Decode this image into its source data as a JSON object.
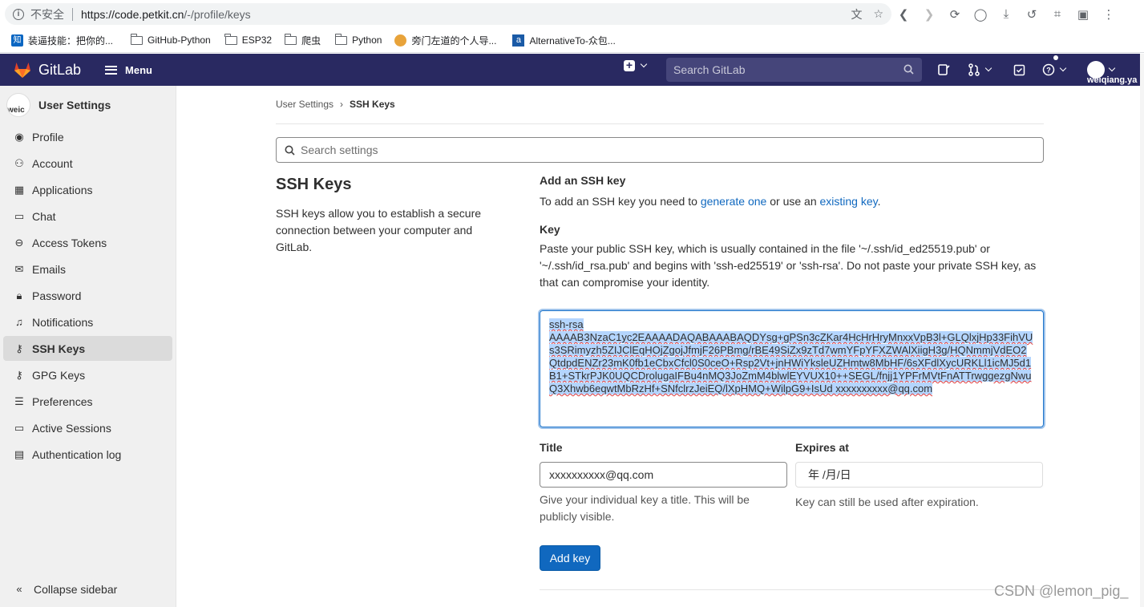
{
  "browser": {
    "insecure_label": "不安全",
    "url_host": "https://code.petkit.cn",
    "url_path": "/-/profile/keys",
    "bookmarks": [
      {
        "icon": "zhi-icon",
        "label": "装逼技能：把你的..."
      },
      {
        "icon": "folder-icon",
        "label": "GitHub-Python"
      },
      {
        "icon": "folder-icon",
        "label": "ESP32"
      },
      {
        "icon": "folder-icon",
        "label": "爬虫"
      },
      {
        "icon": "folder-icon",
        "label": "Python"
      },
      {
        "icon": "cat-icon",
        "label": "旁门左道的个人导..."
      },
      {
        "icon": "alternativeto-icon",
        "label": "AlternativeTo-众包..."
      }
    ]
  },
  "header": {
    "app_name": "GitLab",
    "menu_label": "Menu",
    "search_placeholder": "Search GitLab",
    "username": "weiqiang.ya"
  },
  "sidebar": {
    "title": "User Settings",
    "avatar_alt": "weic",
    "items": [
      {
        "label": "Profile",
        "icon": "user-circle-icon",
        "active": false
      },
      {
        "label": "Account",
        "icon": "account-icon",
        "active": false
      },
      {
        "label": "Applications",
        "icon": "applications-icon",
        "active": false
      },
      {
        "label": "Chat",
        "icon": "chat-icon",
        "active": false
      },
      {
        "label": "Access Tokens",
        "icon": "token-icon",
        "active": false
      },
      {
        "label": "Emails",
        "icon": "mail-icon",
        "active": false
      },
      {
        "label": "Password",
        "icon": "lock-icon",
        "active": false
      },
      {
        "label": "Notifications",
        "icon": "bell-icon",
        "active": false
      },
      {
        "label": "SSH Keys",
        "icon": "key-icon",
        "active": true
      },
      {
        "label": "GPG Keys",
        "icon": "key-icon",
        "active": false
      },
      {
        "label": "Preferences",
        "icon": "preferences-icon",
        "active": false
      },
      {
        "label": "Active Sessions",
        "icon": "monitor-icon",
        "active": false
      },
      {
        "label": "Authentication log",
        "icon": "log-icon",
        "active": false
      }
    ],
    "collapse_label": "Collapse sidebar"
  },
  "breadcrumb": {
    "parent": "User Settings",
    "current": "SSH Keys"
  },
  "search_settings": {
    "placeholder": "Search settings"
  },
  "intro": {
    "title": "SSH Keys",
    "description": "SSH keys allow you to establish a secure connection between your computer and GitLab."
  },
  "form": {
    "heading": "Add an SSH key",
    "intro_prefix": "To add an SSH key you need to ",
    "generate_link": "generate one",
    "intro_middle": " or use an ",
    "existing_link": "existing key",
    "intro_suffix": ".",
    "key_label": "Key",
    "key_help": "Paste your public SSH key, which is usually contained in the file '~/.ssh/id_ed25519.pub' or '~/.ssh/id_rsa.pub' and begins with 'ssh-ed25519' or 'ssh-rsa'. Do not paste your private SSH key, as that can compromise your identity.",
    "key_line1": "ssh-rsa",
    "key_value": "AAAAB3NzaC1yc2EAAAADAQABAAABAQDYsg+gPSn3cZKar4HcHrHryMnxxVpB3l+GLQlxjHp33FihVUs3SRimyzh5ZIJClEqHOjZgojJfmjF26PBmg/rBE49SiZx9zTd7wmYFpYFXZWAlXiigH3g/HQNmmjVdEO2QtdpdENZr23mK0fb1eCbxCfcl0S0ceO+Rsp2Vt+jnHWiYksleUZHmtw8MbHF/6sXFdlXycURKLl1icMJ5d1B1+STkrPJK0UQCDrolugaIFBu4nMQ3JoZmM4blwlEYVUX10++SEGL/fnjj1YPFrMVtFnATTrwggezgNwuQ3Xhwb6eqwtMbRzHf+SNfclrzJeiEQ/lXpHMQ+WilpG9+IsUd xxxxxxxxxx@qq.com",
    "title_label": "Title",
    "title_value": "xxxxxxxxxx@qq.com",
    "title_hint": "Give your individual key a title. This will be publicly visible.",
    "expires_label": "Expires at",
    "expires_value": "年 /月/日",
    "expires_hint": "Key can still be used after expiration.",
    "submit_label": "Add key"
  },
  "watermark": "CSDN @lemon_pig_"
}
